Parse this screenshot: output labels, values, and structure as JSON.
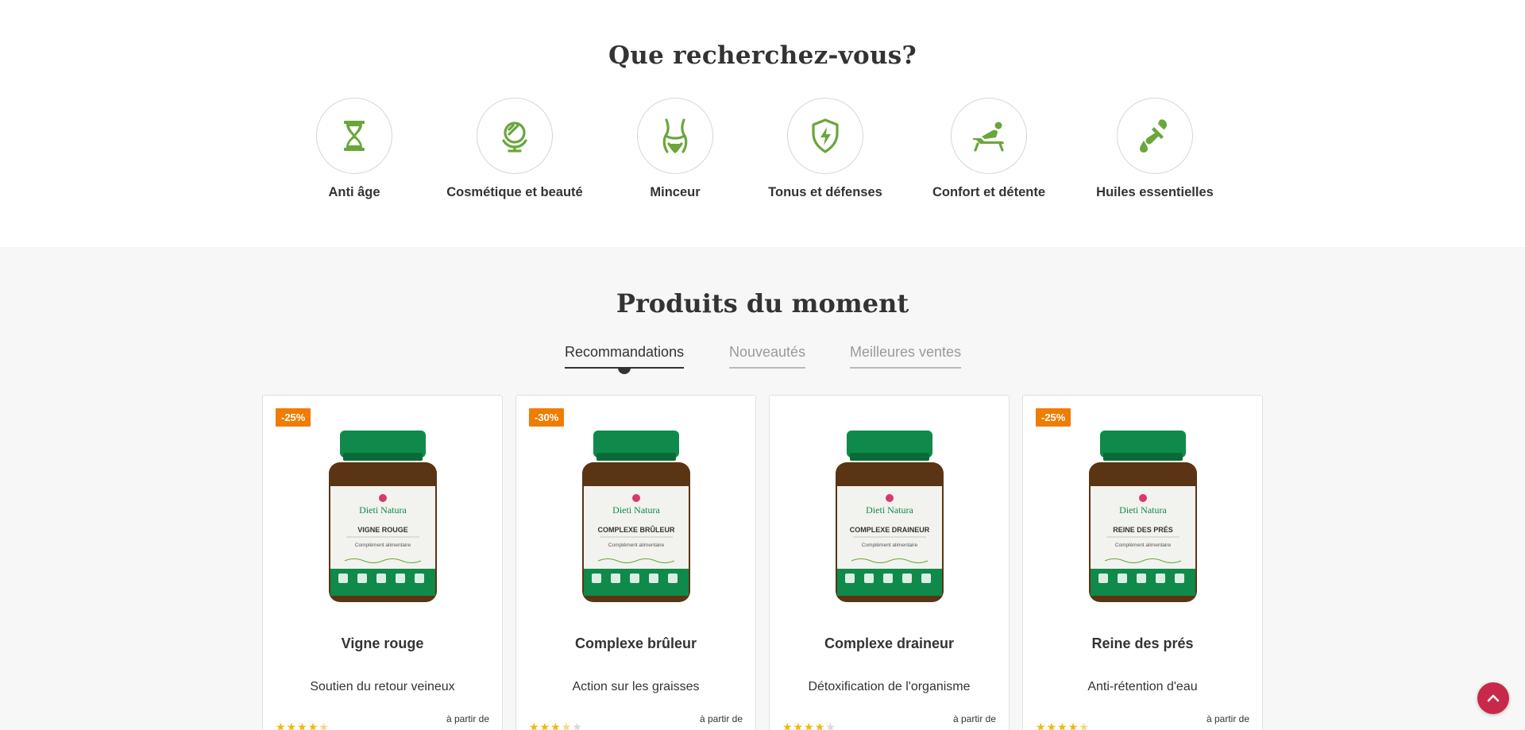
{
  "search": {
    "title": "Que recherchez-vous?",
    "categories": [
      {
        "label": "Anti âge",
        "icon": "hourglass-icon"
      },
      {
        "label": "Cosmétique et beauté",
        "icon": "mirror-icon"
      },
      {
        "label": "Minceur",
        "icon": "waist-icon"
      },
      {
        "label": "Tonus et défenses",
        "icon": "shield-bolt-icon"
      },
      {
        "label": "Confort et détente",
        "icon": "lounge-chair-icon"
      },
      {
        "label": "Huiles essentielles",
        "icon": "dropper-icon"
      }
    ]
  },
  "products": {
    "title": "Produits du moment",
    "tabs": [
      {
        "label": "Recommandations",
        "active": true
      },
      {
        "label": "Nouveautés",
        "active": false
      },
      {
        "label": "Meilleures ventes",
        "active": false
      }
    ],
    "items": [
      {
        "discount": "-25%",
        "brand": "Dieti Natura",
        "jar_label": "VIGNE ROUGE",
        "jar_sub": "Complément alimentaire",
        "name": "Vigne rouge",
        "desc": "Soutien du retour veineux",
        "rating": 4.5,
        "price_prefix": "à partir de"
      },
      {
        "discount": "-30%",
        "brand": "Dieti Natura",
        "jar_label": "COMPLEXE BRÛLEUR",
        "jar_sub": "Complément alimentaire",
        "name": "Complexe brûleur",
        "desc": "Action sur les graisses",
        "rating": 3.5,
        "price_prefix": "à partir de"
      },
      {
        "discount": "",
        "brand": "Dieti Natura",
        "jar_label": "COMPLEXE DRAINEUR",
        "jar_sub": "Complément alimentaire",
        "name": "Complexe draineur",
        "desc": "Détoxification de l'organisme",
        "rating": 4,
        "price_prefix": "à partir de"
      },
      {
        "discount": "-25%",
        "brand": "Dieti Natura",
        "jar_label": "REINE DES PRÉS",
        "jar_sub": "Complément alimentaire",
        "name": "Reine des prés",
        "desc": "Anti-rétention d'eau",
        "rating": 4.5,
        "price_prefix": "à partir de"
      }
    ]
  },
  "colors": {
    "accent_green": "#6aa63a",
    "jar_green": "#0f8a4a",
    "discount_orange": "#f07c00",
    "star_gold": "#f5b800",
    "back_to_top": "#c8294b"
  },
  "back_to_top": {
    "icon": "chevron-up-icon"
  }
}
